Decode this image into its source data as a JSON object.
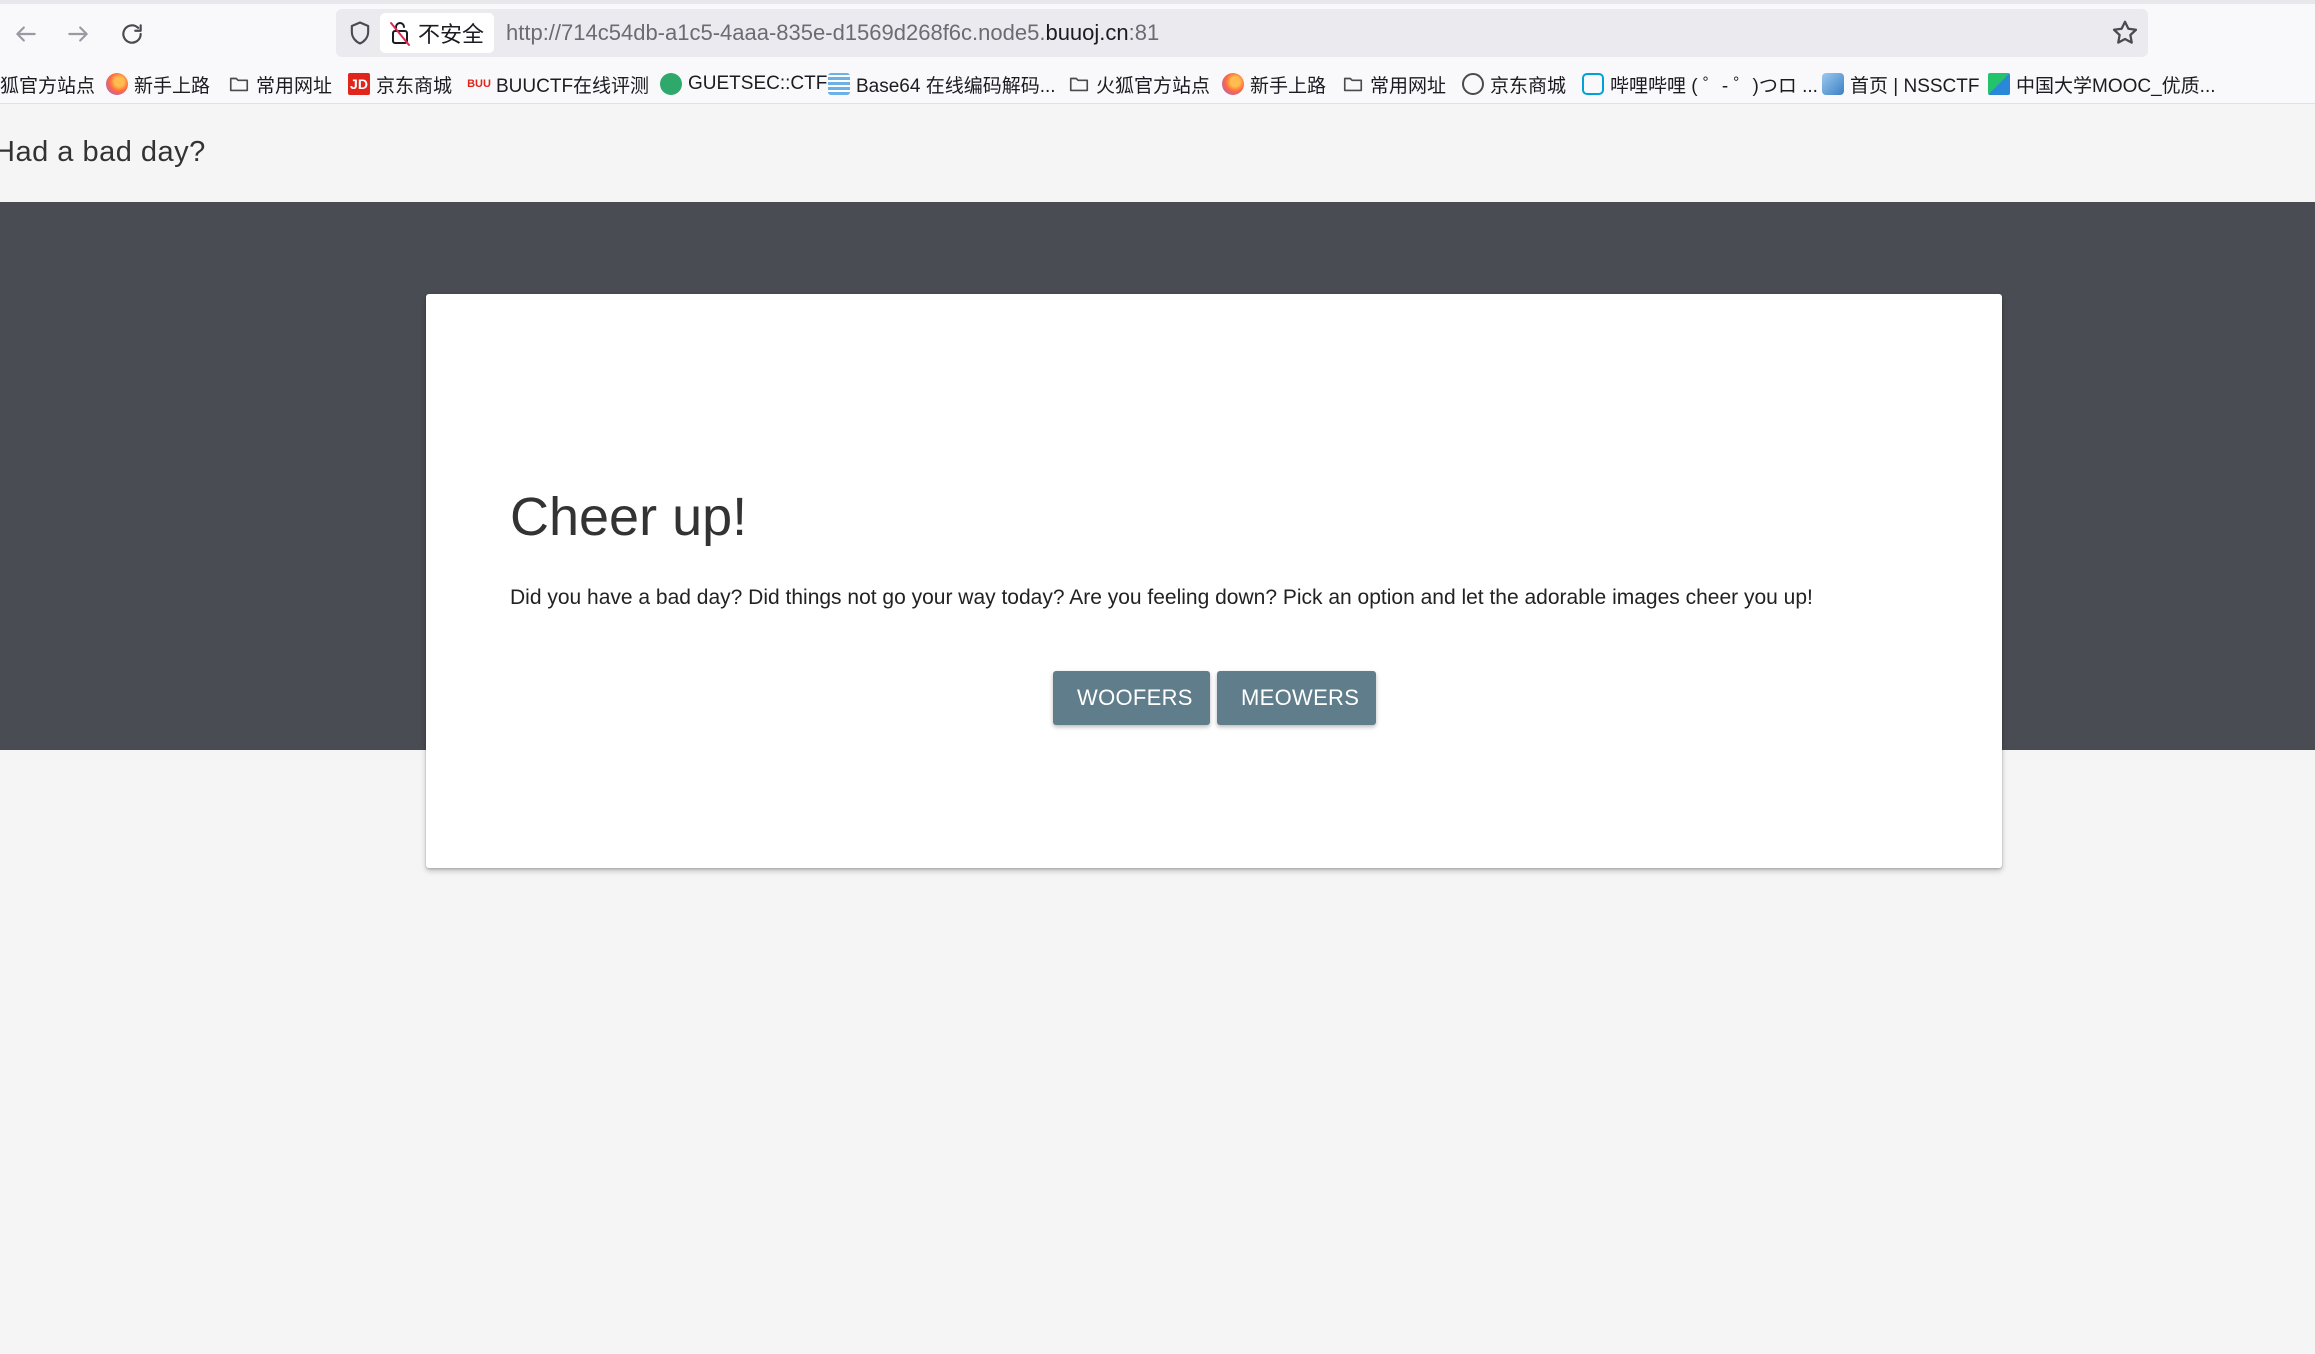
{
  "browser": {
    "url_prefix": "http://714c54db-a1c5-4aaa-835e-d1569d268f6c.node5.",
    "url_host": "buuoj.cn",
    "url_suffix": ":81",
    "security_label": "不安全",
    "nav": {
      "back_icon": "arrow-left-icon",
      "forward_icon": "arrow-right-icon",
      "reload_icon": "reload-icon"
    }
  },
  "bookmarks": [
    {
      "label": "狐官方站点",
      "icon": "none"
    },
    {
      "label": "新手上路",
      "icon": "firefox-icon"
    },
    {
      "label": "常用网址",
      "icon": "folder-icon"
    },
    {
      "label": "京东商城",
      "icon": "jd-icon"
    },
    {
      "label": "BUUCTF在线评测",
      "icon": "buu-icon"
    },
    {
      "label": "GUETSEC::CTF",
      "icon": "guet-icon"
    },
    {
      "label": "Base64 在线编码解码...",
      "icon": "base64-icon"
    },
    {
      "label": "火狐官方站点",
      "icon": "folder-icon"
    },
    {
      "label": "新手上路",
      "icon": "firefox-icon"
    },
    {
      "label": "常用网址",
      "icon": "folder-icon"
    },
    {
      "label": "京东商城",
      "icon": "globe-icon"
    },
    {
      "label": "哔哩哔哩 ( ゜- ゜)つロ ...",
      "icon": "bilibili-icon"
    },
    {
      "label": "首页 | NSSCTF",
      "icon": "nssctf-icon"
    },
    {
      "label": "中国大学MOOC_优质...",
      "icon": "mooc-icon"
    }
  ],
  "site": {
    "title": "Had a bad day?"
  },
  "card": {
    "heading": "Cheer up!",
    "text": "Did you have a bad day? Did things not go your way today? Are you feeling down? Pick an option and let the adorable images cheer you up!",
    "buttons": {
      "woofers": "WOOFERS",
      "meowers": "MEOWERS"
    }
  },
  "colors": {
    "hero_band": "#494c52",
    "button": "#607d8b",
    "page_bg": "#f5f5f5"
  }
}
